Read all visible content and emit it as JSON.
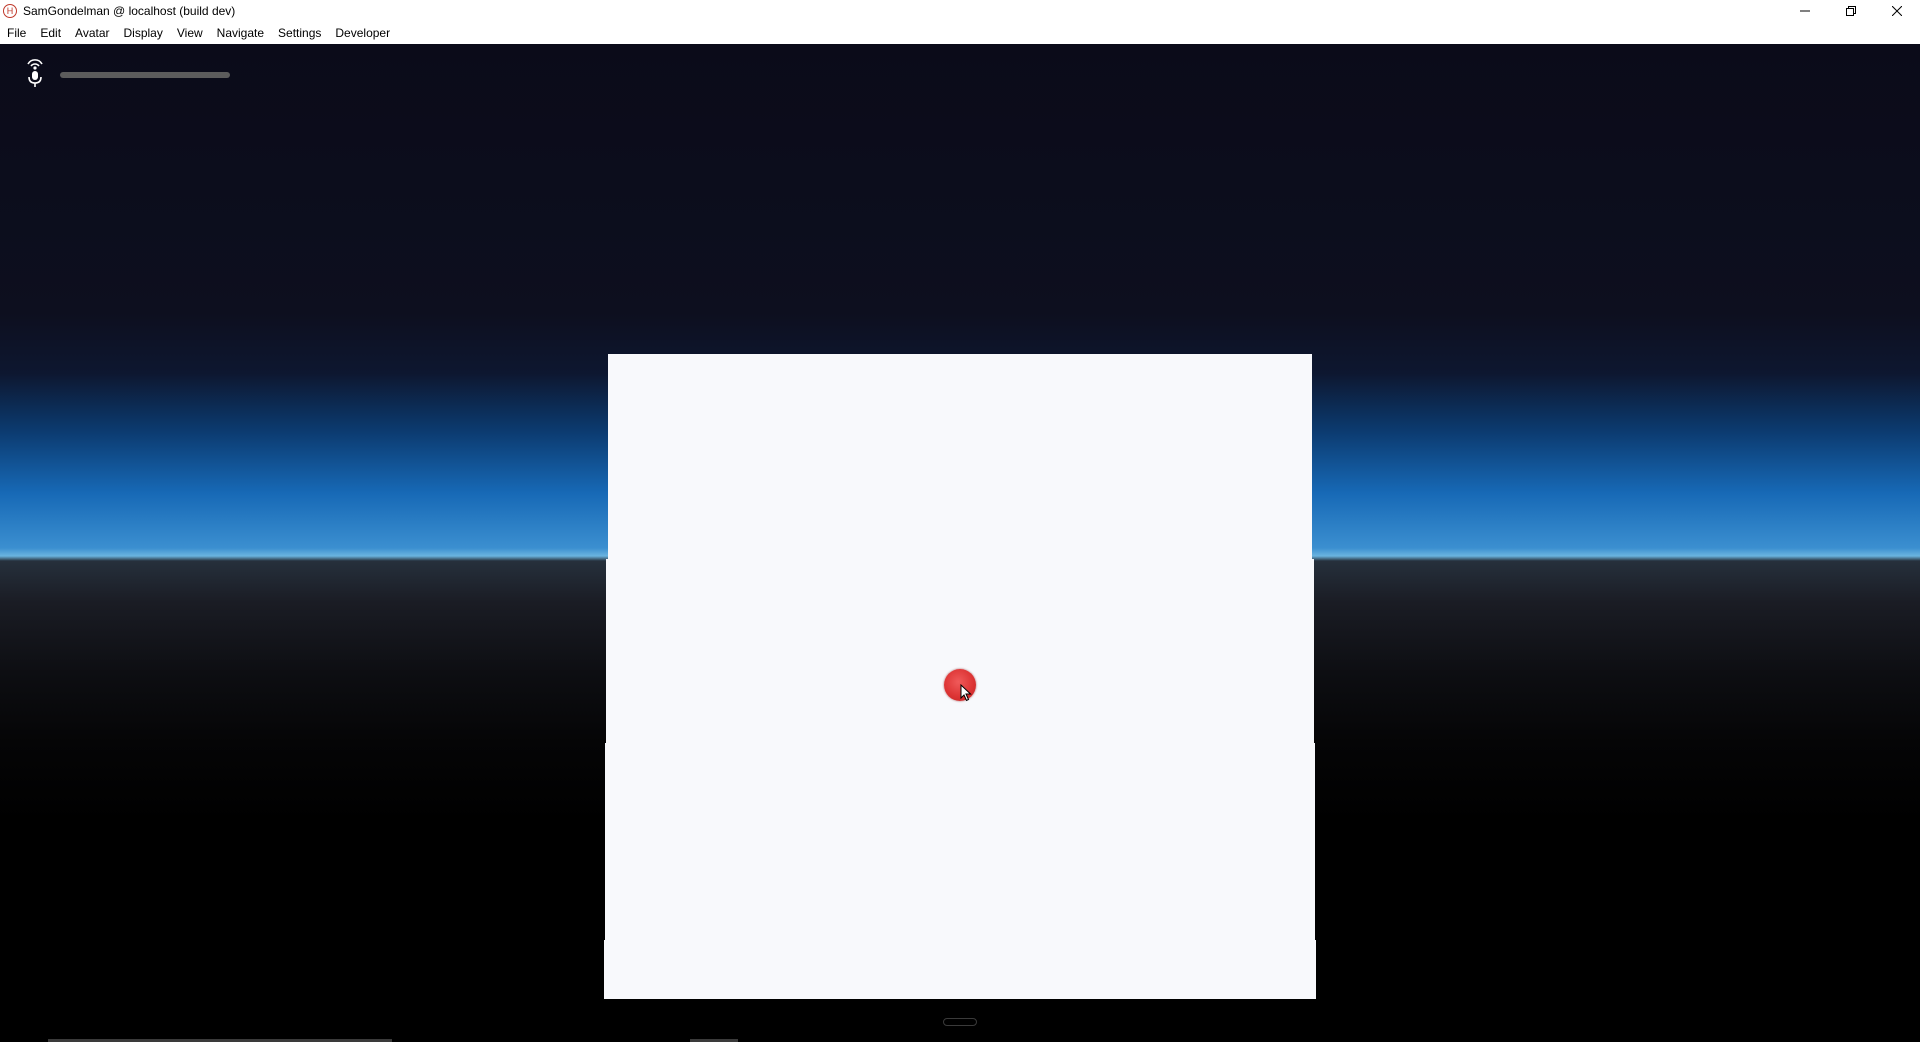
{
  "window": {
    "title": "SamGondelman @ localhost (build dev)",
    "app_icon": "hifi-logo-icon"
  },
  "window_controls": {
    "minimize_icon": "minimize-icon",
    "restore_icon": "restore-icon",
    "close_icon": "close-icon"
  },
  "menubar": {
    "items": [
      "File",
      "Edit",
      "Avatar",
      "Display",
      "View",
      "Navigate",
      "Settings",
      "Developer"
    ]
  },
  "hud": {
    "mic_icon": "microphone-icon",
    "audio_level": 0.0
  },
  "scene": {
    "reticle_color": "#dd3535",
    "panel_color": "#f8f9fc",
    "horizon_color": "#3b8fd0"
  }
}
